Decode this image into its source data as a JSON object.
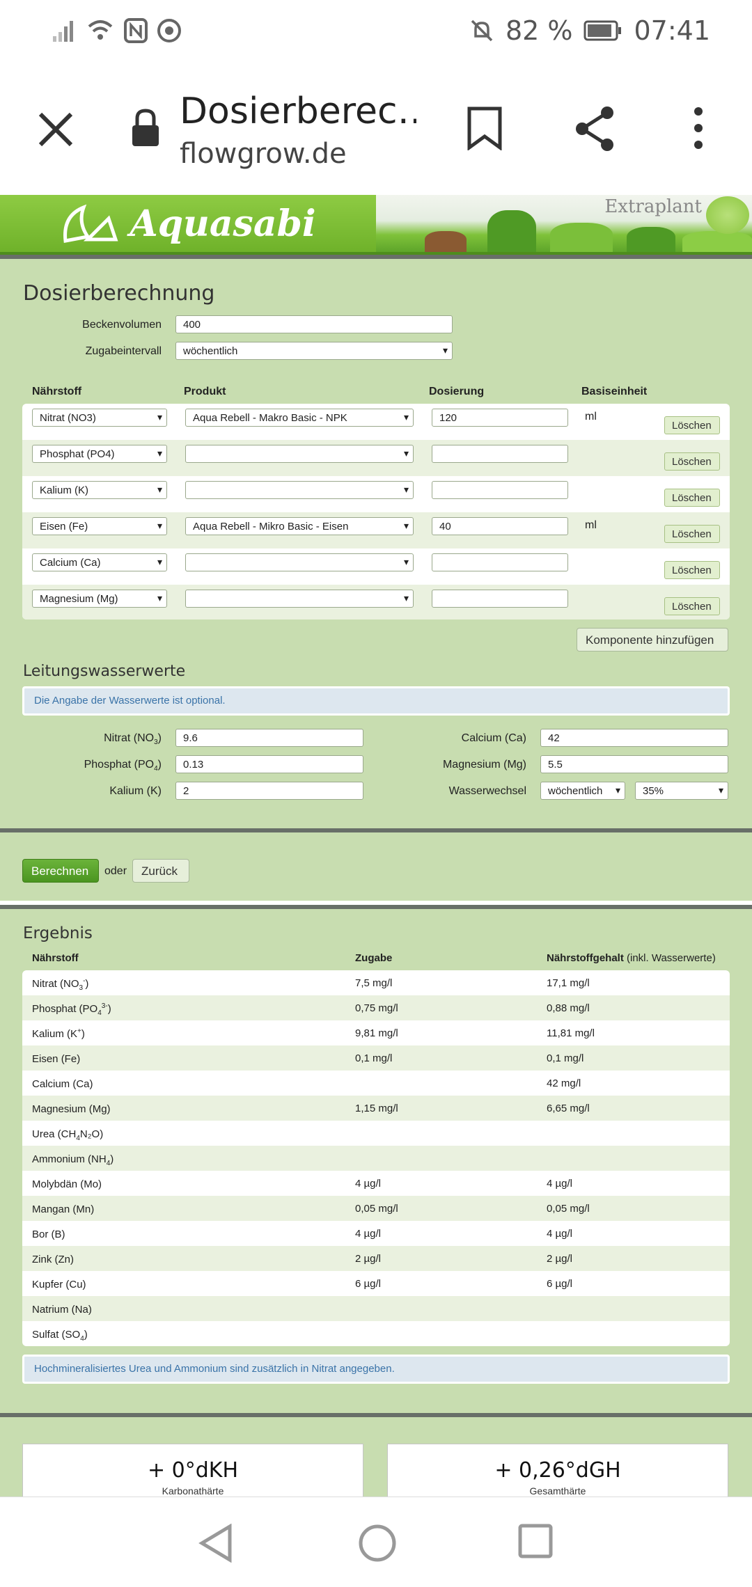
{
  "status": {
    "battery_percent": "82 %",
    "time": "07:41"
  },
  "browser": {
    "page_title": "Dosierberec…",
    "domain": "flowgrow.de"
  },
  "banner": {
    "brand": "Aquasabi",
    "partner": "Extraplant"
  },
  "dosing": {
    "heading": "Dosierberechnung",
    "tank_volume_label": "Beckenvolumen",
    "tank_volume_value": "400",
    "interval_label": "Zugabeintervall",
    "interval_value": "wöchentlich",
    "col_nutrient": "Nährstoff",
    "col_product": "Produkt",
    "col_dosage": "Dosierung",
    "col_base_unit": "Basiseinheit",
    "delete_label": "Löschen",
    "rows": [
      {
        "nutrient": "Nitrat (NO3)",
        "product": "Aqua Rebell - Makro Basic - NPK",
        "dosage": "120",
        "unit": "ml"
      },
      {
        "nutrient": "Phosphat (PO4)",
        "product": "",
        "dosage": "",
        "unit": ""
      },
      {
        "nutrient": "Kalium (K)",
        "product": "",
        "dosage": "",
        "unit": ""
      },
      {
        "nutrient": "Eisen (Fe)",
        "product": "Aqua Rebell - Mikro Basic - Eisen",
        "dosage": "40",
        "unit": "ml"
      },
      {
        "nutrient": "Calcium (Ca)",
        "product": "",
        "dosage": "",
        "unit": ""
      },
      {
        "nutrient": "Magnesium (Mg)",
        "product": "",
        "dosage": "",
        "unit": ""
      }
    ],
    "add_component_label": "Komponente hinzufügen"
  },
  "tapwater": {
    "heading": "Leitungswasserwerte",
    "info": "Die Angabe der Wasserwerte ist optional.",
    "nitrat_label_pre": "Nitrat (NO",
    "nitrat_sub": "3",
    "nitrat_label_post": ")",
    "nitrat_value": "9.6",
    "phosphat_label_pre": "Phosphat (PO",
    "phosphat_sub": "4",
    "phosphat_label_post": ")",
    "phosphat_value": "0.13",
    "kalium_label": "Kalium (K)",
    "kalium_value": "2",
    "calcium_label": "Calcium (Ca)",
    "calcium_value": "42",
    "magnesium_label": "Magnesium (Mg)",
    "magnesium_value": "5.5",
    "waterchange_label": "Wasserwechsel",
    "waterchange_interval": "wöchentlich",
    "waterchange_percent": "35%"
  },
  "actions": {
    "calculate_label": "Berechnen",
    "or_label": "oder",
    "back_label": "Zurück"
  },
  "result": {
    "heading": "Ergebnis",
    "col_nutrient": "Nährstoff",
    "col_addition": "Zugabe",
    "col_content": "Nährstoffgehalt",
    "col_content_note": "(inkl. Wasserwerte)",
    "rows": [
      {
        "name": "Nitrat (NO",
        "sub": "3",
        "sup": "-",
        "tail": ")",
        "add": "7,5 mg/l",
        "total": "17,1 mg/l"
      },
      {
        "name": "Phosphat (PO",
        "sub": "4",
        "sup": "3-",
        "tail": ")",
        "add": "0,75 mg/l",
        "total": "0,88 mg/l"
      },
      {
        "name": "Kalium (K",
        "sub": "",
        "sup": "+",
        "tail": ")",
        "add": "9,81 mg/l",
        "total": "11,81 mg/l"
      },
      {
        "name": "Eisen (Fe)",
        "sub": "",
        "sup": "",
        "tail": "",
        "add": "0,1 mg/l",
        "total": "0,1 mg/l"
      },
      {
        "name": "Calcium (Ca)",
        "sub": "",
        "sup": "",
        "tail": "",
        "add": "",
        "total": "42 mg/l"
      },
      {
        "name": "Magnesium (Mg)",
        "sub": "",
        "sup": "",
        "tail": "",
        "add": "1,15 mg/l",
        "total": "6,65 mg/l"
      },
      {
        "name": "Urea (CH",
        "sub": "4",
        "sup": "",
        "tail": "N₂O)",
        "add": "",
        "total": ""
      },
      {
        "name": "Ammonium (NH",
        "sub": "4",
        "sup": "",
        "tail": ")",
        "add": "",
        "total": ""
      },
      {
        "name": "Molybdän (Mo)",
        "sub": "",
        "sup": "",
        "tail": "",
        "add": "4 µg/l",
        "total": "4 µg/l"
      },
      {
        "name": "Mangan (Mn)",
        "sub": "",
        "sup": "",
        "tail": "",
        "add": "0,05 mg/l",
        "total": "0,05 mg/l"
      },
      {
        "name": "Bor (B)",
        "sub": "",
        "sup": "",
        "tail": "",
        "add": "4 µg/l",
        "total": "4 µg/l"
      },
      {
        "name": "Zink (Zn)",
        "sub": "",
        "sup": "",
        "tail": "",
        "add": "2 µg/l",
        "total": "2 µg/l"
      },
      {
        "name": "Kupfer (Cu)",
        "sub": "",
        "sup": "",
        "tail": "",
        "add": "6 µg/l",
        "total": "6 µg/l"
      },
      {
        "name": "Natrium (Na)",
        "sub": "",
        "sup": "",
        "tail": "",
        "add": "",
        "total": ""
      },
      {
        "name": "Sulfat (SO",
        "sub": "4",
        "sup": "",
        "tail": ")",
        "add": "",
        "total": ""
      }
    ],
    "note": "Hochmineralisiertes Urea und Ammonium sind zusätzlich in Nitrat angegeben."
  },
  "hardness": {
    "kh_value": "+ 0°dKH",
    "kh_label": "Karbonathärte",
    "gh_value": "+ 0,26°dGH",
    "gh_label": "Gesamthärte"
  }
}
